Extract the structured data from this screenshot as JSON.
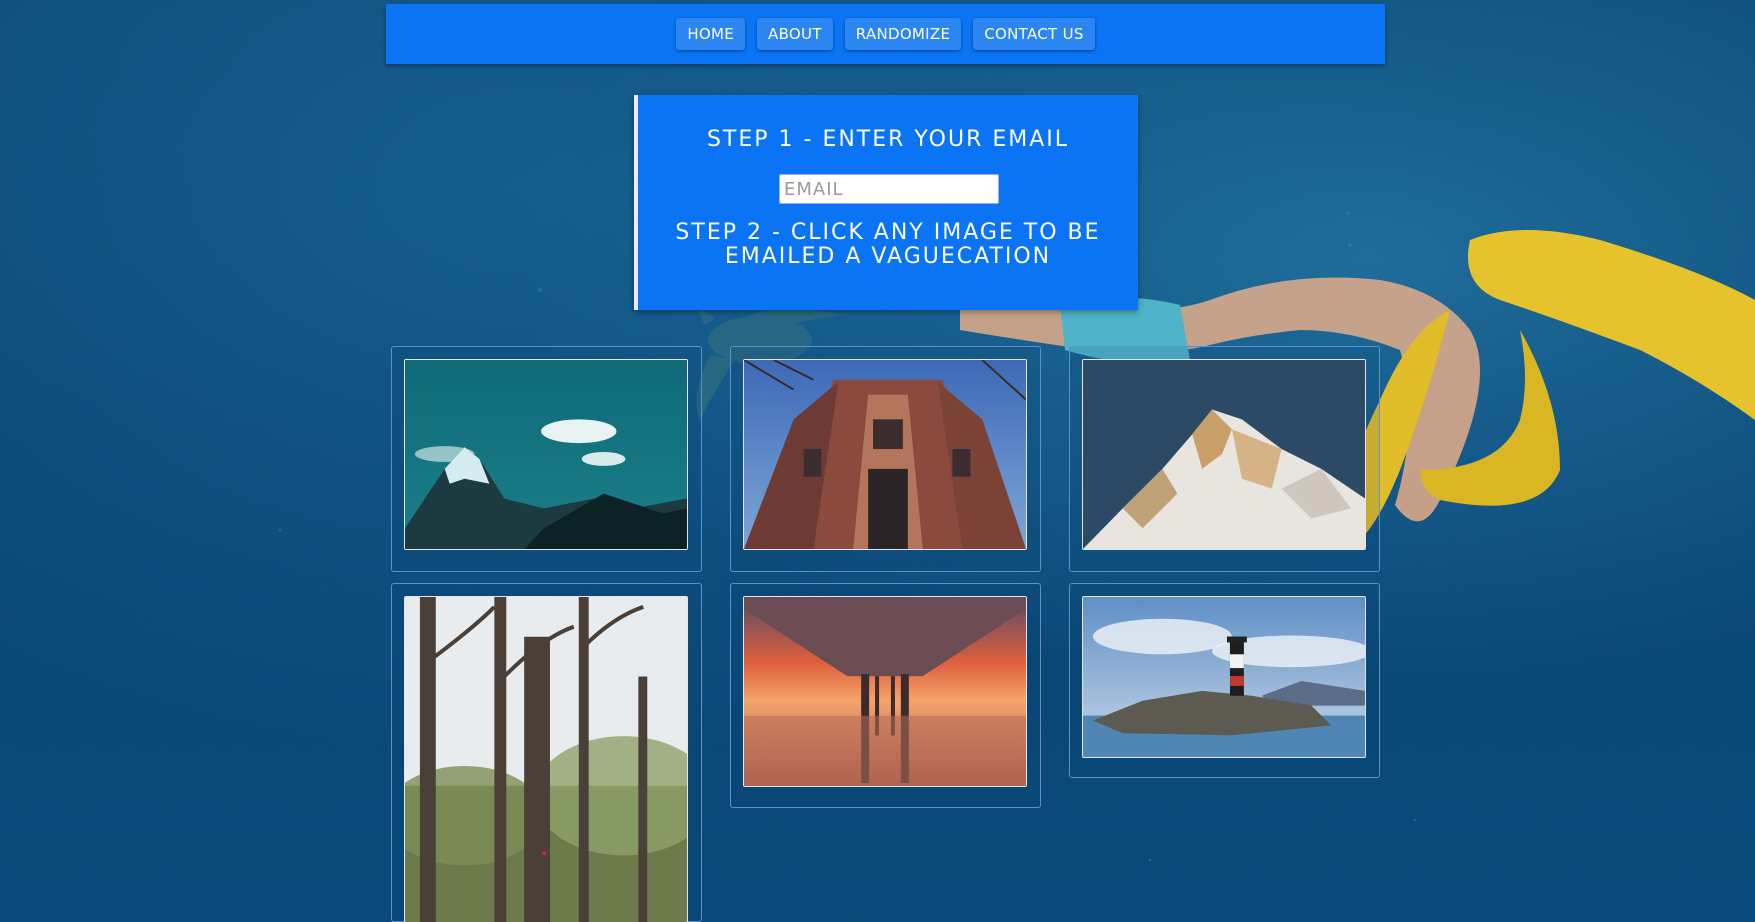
{
  "nav": {
    "items": [
      {
        "label": "HOME"
      },
      {
        "label": "ABOUT"
      },
      {
        "label": "RANDOMIZE"
      },
      {
        "label": "CONTACT US"
      }
    ]
  },
  "form": {
    "step1": "STEP 1 - ENTER YOUR EMAIL",
    "email_placeholder": "EMAIL",
    "email_value": "",
    "step2": "STEP 2 - CLICK ANY IMAGE TO BE EMAILED A VAGUECATION"
  },
  "colors": {
    "accent": "#0a74f5",
    "button": "#2c86f2",
    "background": "#0b4a78"
  },
  "gallery": {
    "images": [
      {
        "subject": "teal mountain with clouds"
      },
      {
        "subject": "ornate brick building viewed from below"
      },
      {
        "subject": "snowy mountain peak"
      },
      {
        "subject": "tall trees in a forest"
      },
      {
        "subject": "pier at sunset over water"
      },
      {
        "subject": "lighthouse on rocky island"
      }
    ]
  }
}
